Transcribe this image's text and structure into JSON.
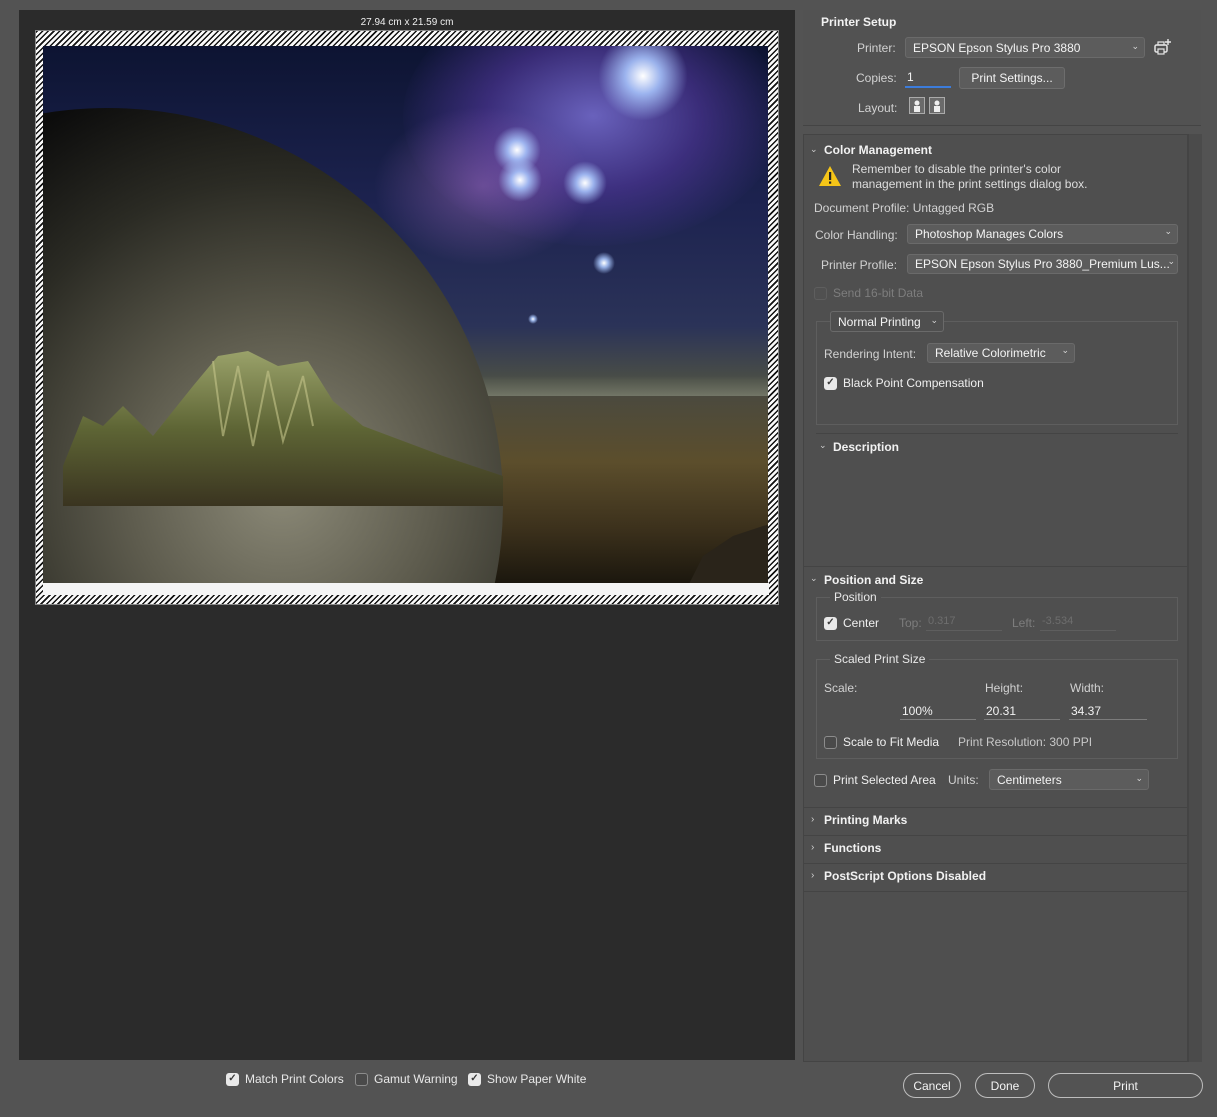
{
  "preview": {
    "paper_size": "27.94 cm x 21.59 cm"
  },
  "preview_options": {
    "match_print_colors": {
      "label": "Match Print Colors",
      "checked": true
    },
    "gamut_warning": {
      "label": "Gamut Warning",
      "checked": false
    },
    "show_paper_white": {
      "label": "Show Paper White",
      "checked": true
    }
  },
  "printer_setup": {
    "title": "Printer Setup",
    "printer_label": "Printer:",
    "printer_value": "EPSON Epson Stylus Pro 3880",
    "copies_label": "Copies:",
    "copies_value": "1",
    "print_settings_button": "Print Settings...",
    "layout_label": "Layout:"
  },
  "color_management": {
    "title": "Color Management",
    "warning": "Remember to disable the printer's color management in the print settings dialog box.",
    "warning_line1": "Remember to disable the printer's color",
    "warning_line2": "management in the print settings dialog box.",
    "document_profile": "Document Profile: Untagged RGB",
    "color_handling_label": "Color Handling:",
    "color_handling_value": "Photoshop Manages Colors",
    "printer_profile_label": "Printer Profile:",
    "printer_profile_value": "EPSON Epson Stylus Pro 3880_Premium Lus...",
    "send_16bit": {
      "label": "Send 16-bit Data",
      "checked": false,
      "disabled": true
    },
    "printing_mode": "Normal Printing",
    "rendering_intent_label": "Rendering Intent:",
    "rendering_intent_value": "Relative Colorimetric",
    "black_point": {
      "label": "Black Point Compensation",
      "checked": true
    }
  },
  "description": {
    "title": "Description"
  },
  "position_and_size": {
    "title": "Position and Size",
    "position_group": "Position",
    "center": {
      "label": "Center",
      "checked": true
    },
    "top_label": "Top:",
    "top_value": "0.317",
    "left_label": "Left:",
    "left_value": "-3.534",
    "scaled_group": "Scaled Print Size",
    "scale_label": "Scale:",
    "height_label": "Height:",
    "width_label": "Width:",
    "scale_value": "100%",
    "height_value": "20.31",
    "width_value": "34.37",
    "scale_to_fit": {
      "label": "Scale to Fit Media",
      "checked": false
    },
    "print_resolution": "Print Resolution: 300 PPI",
    "print_selected_area": {
      "label": "Print Selected Area",
      "checked": false
    },
    "units_label": "Units:",
    "units_value": "Centimeters"
  },
  "collapsed_sections": {
    "printing_marks": "Printing Marks",
    "functions": "Functions",
    "postscript": "PostScript Options Disabled"
  },
  "footer": {
    "cancel": "Cancel",
    "done": "Done",
    "print": "Print"
  },
  "colors": {
    "dialog_bg": "#535353",
    "preview_bg": "#2b2b2b",
    "focus_accent": "#3c7cdb",
    "warning_yellow": "#f5c518"
  }
}
